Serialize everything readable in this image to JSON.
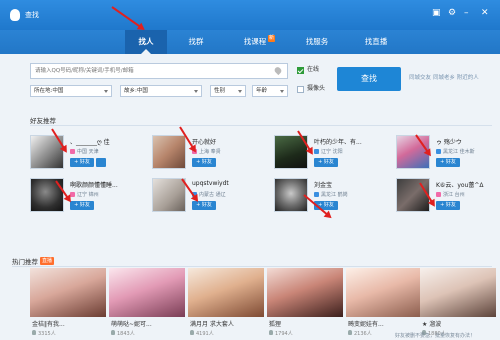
{
  "window": {
    "title": "查找"
  },
  "tabs": [
    {
      "label": "找人",
      "active": true
    },
    {
      "label": "找群",
      "active": false
    },
    {
      "label": "找课程",
      "active": false,
      "badge": "新"
    },
    {
      "label": "找服务",
      "active": false
    },
    {
      "label": "找直播",
      "active": false
    }
  ],
  "search": {
    "placeholder": "请输入QQ号码/昵称/关键词/手机号/邮箱",
    "online_label": "在线",
    "online_checked": true,
    "camera_label": "摄像头",
    "camera_checked": false,
    "button": "查找",
    "extra1": "同城交友",
    "extra2": "同城老乡 附近的人"
  },
  "filters": [
    {
      "label": "所在地:中国"
    },
    {
      "label": "故乡:中国"
    },
    {
      "label": "性别"
    },
    {
      "label": "年龄"
    }
  ],
  "friends_section": {
    "title": "好友推荐",
    "add_label": "+ 好友"
  },
  "people": [
    {
      "name": "、_______ღ 佳",
      "loc": "中国 天津",
      "gender": "female"
    },
    {
      "name": "开心就好",
      "loc": "上海 奉贤",
      "gender": "female"
    },
    {
      "name": "叶朽的少年、有...",
      "loc": "辽宁 沈阳",
      "gender": "male"
    },
    {
      "name": "ゥ 殇少ウ",
      "loc": "黑龙江 佳木斯",
      "gender": "male"
    },
    {
      "name": "啊歌颜颜懂懂睡...",
      "loc": "辽宁 锦州",
      "gender": "female"
    },
    {
      "name": "upqstvwiydt",
      "loc": "内蒙古 通辽",
      "gender": "male"
    },
    {
      "name": "刘金宝",
      "loc": "黑龙江 鹤岗",
      "gender": "male"
    },
    {
      "name": "K⑥云、you蕾^Δ",
      "loc": "浙江 台州",
      "gender": "female"
    }
  ],
  "hot_section": {
    "title": "热门推荐",
    "badge": "直播"
  },
  "hot": [
    {
      "name": "金桔‖有我...",
      "count": "3315人"
    },
    {
      "name": "萌萌哒~妮可...",
      "count": "1843人"
    },
    {
      "name": "满月月 求大套人",
      "count": "4191人"
    },
    {
      "name": "狐狸",
      "count": "1794人"
    },
    {
      "name": "畸变妮娃有...",
      "count": "2136人"
    },
    {
      "name": "★ 溜波",
      "count": "1880人"
    }
  ],
  "footer_hint": "好友被删不要急，批量恢复有办法！",
  "colors": {
    "accent": "#1e86d6",
    "arrow": "#e0201f",
    "hot_badge": "#ff6e2c",
    "new_badge": "#ff7a1a"
  }
}
